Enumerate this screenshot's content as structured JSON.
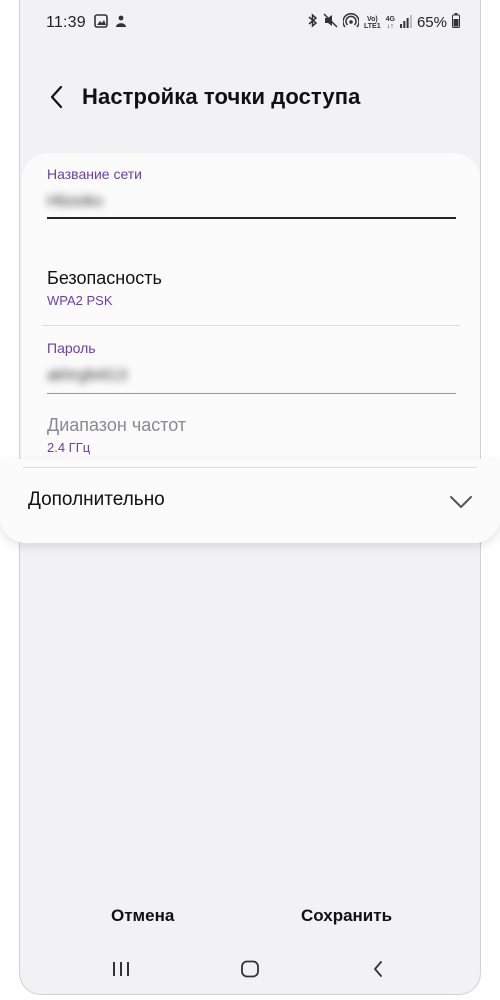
{
  "status_bar": {
    "time": "11:39",
    "network_top": "Vo)",
    "network_bottom": "LTE1",
    "gen_top": "4G",
    "gen_bottom": "↓↑",
    "battery": "65%"
  },
  "header": {
    "title": "Настройка точки доступа"
  },
  "form": {
    "network_name_label": "Название сети",
    "network_name_value": "Hlizeiko",
    "security_label": "Безопасность",
    "security_value": "WPA2 PSK",
    "password_label": "Пароль",
    "password_value": "akhrgfe613",
    "band_label": "Диапазон частот",
    "band_value": "2.4 ГГц"
  },
  "advanced": {
    "label": "Дополнительно"
  },
  "actions": {
    "cancel": "Отмена",
    "save": "Сохранить"
  },
  "colors": {
    "accent": "#6b3ea8",
    "background": "#f2f2f4",
    "card": "#fbfbfc"
  }
}
